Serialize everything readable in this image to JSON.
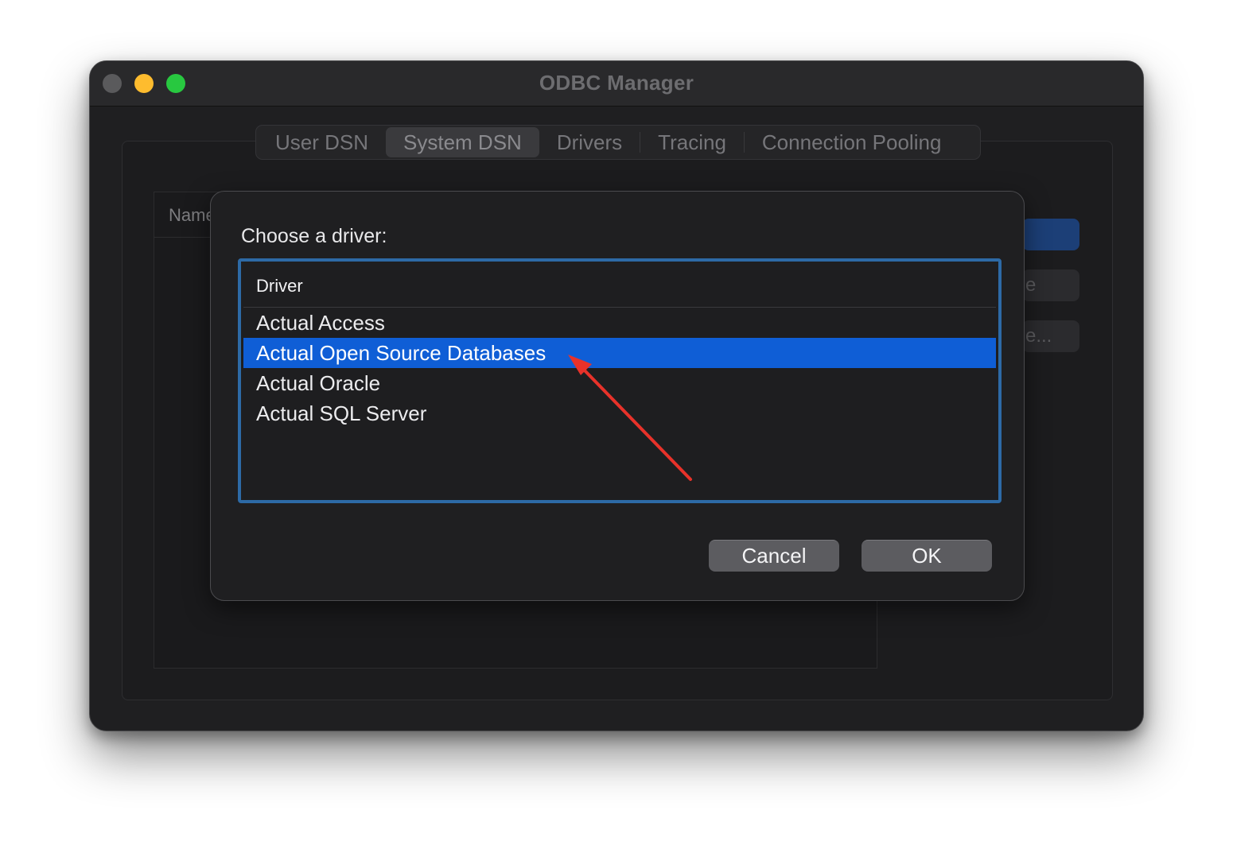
{
  "window": {
    "title": "ODBC Manager"
  },
  "tabs": [
    {
      "label": "User DSN",
      "selected": false
    },
    {
      "label": "System DSN",
      "selected": true
    },
    {
      "label": "Drivers",
      "selected": false
    },
    {
      "label": "Tracing",
      "selected": false
    },
    {
      "label": "Connection Pooling",
      "selected": false
    }
  ],
  "background_table": {
    "header_partial": "Name"
  },
  "side_buttons": {
    "partial_2": "e",
    "partial_3": "e..."
  },
  "dialog": {
    "prompt": "Choose a driver:",
    "list_header": "Driver",
    "drivers": [
      "Actual Access",
      "Actual Open Source Databases",
      "Actual Oracle",
      "Actual SQL Server"
    ],
    "selected_index": 1,
    "cancel_label": "Cancel",
    "ok_label": "OK"
  },
  "colors": {
    "selection": "#0f5ed6",
    "focus_ring": "#2d6aa6",
    "arrow": "#e8322a"
  }
}
